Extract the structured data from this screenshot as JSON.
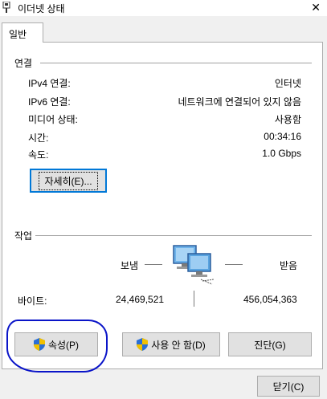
{
  "window": {
    "title": "이더넷 상태",
    "close_glyph": "✕"
  },
  "tabs": [
    {
      "label": "일반",
      "selected": true
    }
  ],
  "connection": {
    "group_label": "연결",
    "rows": [
      {
        "label": "IPv4 연결:",
        "value": "인터넷"
      },
      {
        "label": "IPv6 연결:",
        "value": "네트워크에 연결되어 있지 않음"
      },
      {
        "label": "미디어 상태:",
        "value": "사용함"
      },
      {
        "label": "시간:",
        "value": "00:34:16"
      },
      {
        "label": "속도:",
        "value": "1.0 Gbps"
      }
    ],
    "details_button": "자세히(E)..."
  },
  "activity": {
    "group_label": "작업",
    "sent_label": "보냄",
    "received_label": "받음",
    "bytes_label": "바이트:",
    "bytes_sent": "24,469,521",
    "bytes_received": "456,054,363"
  },
  "buttons": {
    "properties": "속성(P)",
    "disable": "사용 안 함(D)",
    "diagnose": "진단(G)",
    "close": "닫기(C)"
  },
  "colors": {
    "accent": "#0078d7",
    "annotation_circle": "#0a14c8",
    "shield_blue": "#2a6fd6",
    "shield_yellow": "#f2c100"
  }
}
